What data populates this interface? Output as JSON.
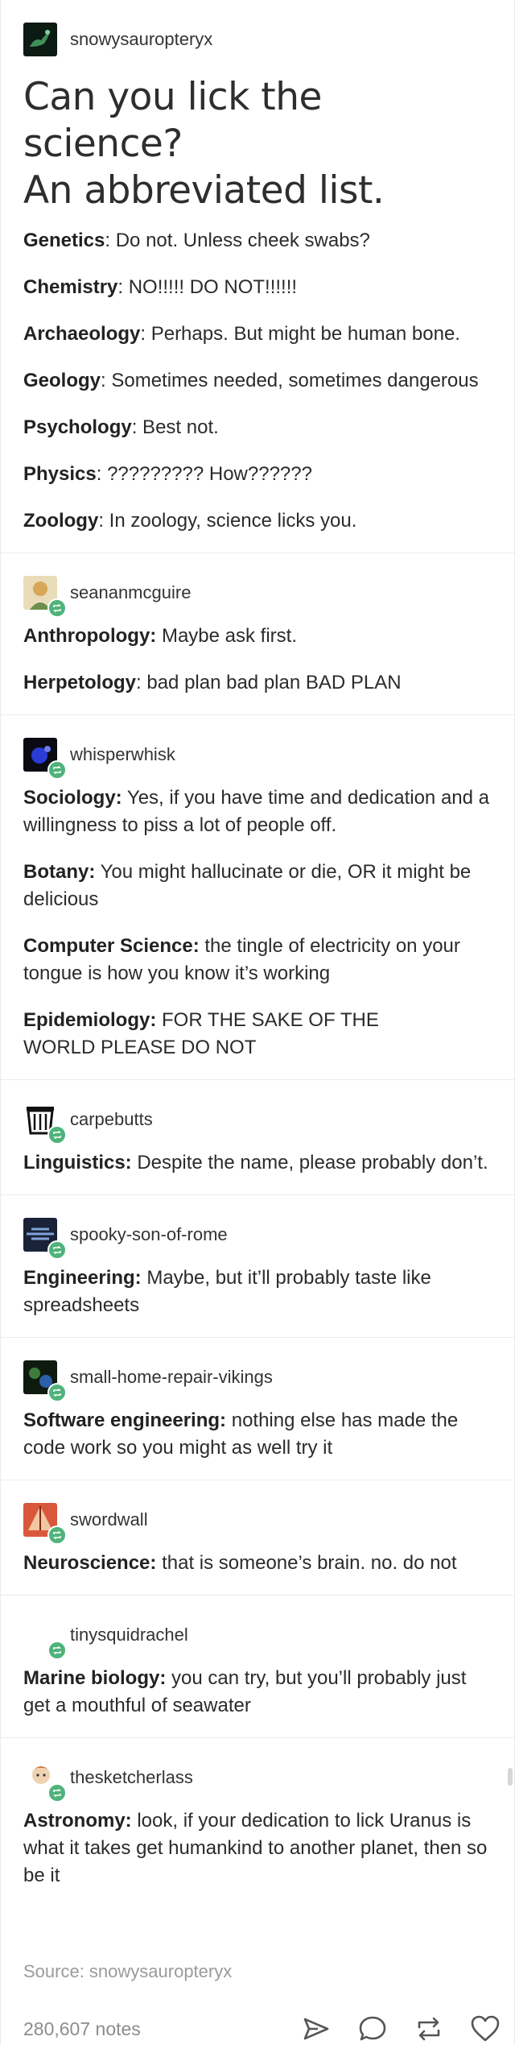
{
  "post": {
    "op": {
      "username": "snowysauropteryx"
    },
    "title_line1": "Can you lick the science?",
    "title_line2": "An abbreviated list.",
    "op_items": [
      {
        "term": "Genetics",
        "text": ": Do not. Unless cheek swabs?"
      },
      {
        "term": "Chemistry",
        "text": ": NO!!!!! DO NOT!!!!!!"
      },
      {
        "term": "Archaeology",
        "text": ": Perhaps. But might be human bone."
      },
      {
        "term": "Geology",
        "text": ": Sometimes needed, sometimes dangerous"
      },
      {
        "term": "Psychology",
        "text": ": Best not."
      },
      {
        "term": "Physics",
        "text": ": ????????? How??????"
      },
      {
        "term": "Zoology",
        "text": ": In zoology, science licks you."
      }
    ],
    "reblogs": [
      {
        "username": "seananmcguire",
        "items": [
          {
            "term": "Anthropology:",
            "text": " Maybe ask first."
          },
          {
            "term": "Herpetology",
            "text": ": bad plan bad plan BAD PLAN"
          }
        ]
      },
      {
        "username": "whisperwhisk",
        "items": [
          {
            "term": "Sociology:",
            "text": " Yes, if you have time and dedication and a willingness to piss a lot of people off."
          },
          {
            "term": "Botany:",
            "text": " You might hallucinate or die, OR it might be delicious"
          },
          {
            "term": "Computer Science:",
            "text": " the tingle of electricity on your tongue is how you know it’s working"
          },
          {
            "term": "Epidemiology:",
            "text": " FOR THE SAKE OF THE WORLD PLEASE DO NOT"
          }
        ]
      },
      {
        "username": "carpebutts",
        "items": [
          {
            "term": "Linguistics:",
            "text": " Despite the name, please probably don’t."
          }
        ]
      },
      {
        "username": "spooky-son-of-rome",
        "items": [
          {
            "term": "Engineering:",
            "text": " Maybe, but it’ll probably taste like spreadsheets"
          }
        ]
      },
      {
        "username": "small-home-repair-vikings",
        "items": [
          {
            "term": "Software engineering:",
            "text": " nothing else has made the code work so you might as well try it"
          }
        ]
      },
      {
        "username": "swordwall",
        "items": [
          {
            "term": "Neuroscience:",
            "text": " that is someone’s brain. no. do not"
          }
        ]
      },
      {
        "username": "tinysquidrachel",
        "items": [
          {
            "term": "Marine biology:",
            "text": " you can try, but you’ll probably just get a mouthful of seawater"
          }
        ]
      },
      {
        "username": "thesketcherlass",
        "items": [
          {
            "term": "Astronomy:",
            "text": " look, if your dedication to lick Uranus is what it takes get humankind to another planet, then so be it"
          }
        ]
      }
    ],
    "source": "Source: snowysauropteryx",
    "notes": "280,607 notes",
    "icons": {
      "share": "share-icon",
      "reply": "reply-icon",
      "reblog": "reblog-icon",
      "like": "heart-icon",
      "reblog_badge": "reblog-badge-icon"
    },
    "colors": {
      "reblog_badge": "#4fb37a",
      "text": "#2b2b2b",
      "muted": "#9a9a9a",
      "divider": "#ececec"
    }
  }
}
